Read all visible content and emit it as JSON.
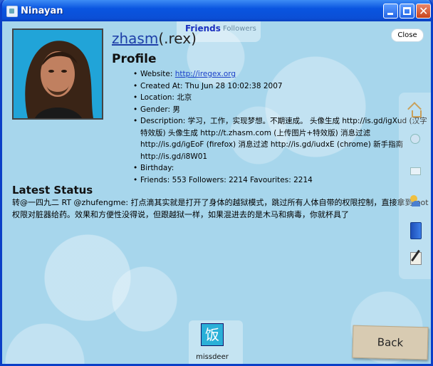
{
  "window": {
    "title": "Ninayan"
  },
  "tabs": {
    "friends": "Friends",
    "followers": "Followers"
  },
  "close_label": "Close",
  "profile": {
    "username": "zhasm",
    "screen_name": "(.rex)",
    "heading": "Profile",
    "website_label": "Website:",
    "website_url": "http://iregex.org",
    "created_at": "Created At: Thu Jun 28 10:02:38 2007",
    "location": "Location: 北京",
    "gender": "Gender: 男",
    "description": "Description: 学习，工作，实现梦想。不期速成。 头像生成 http://is.gd/igXud (汉字特效版) 头像生成 http://t.zhasm.com (上传图片+特效版) 消息过滤 http://is.gd/igEoF (firefox) 消息过滤 http://is.gd/iudxE (chrome) 新手指南 http://is.gd/i8W01",
    "birthday": "Birthday:",
    "counts": "Friends: 553 Followers: 2214 Favourites: 2214"
  },
  "status": {
    "heading": "Latest Status",
    "text": "转@一四九二 RT @zhufengme: 打点滴其实就是打开了身体的越狱模式，跳过所有人体自带的权限控制，直接拿到root权限对脏器给药。效果和方便性没得说，但跟越狱一样，如果混进去的是木马和病毒，你就杯具了"
  },
  "side_icons": [
    "home-icon",
    "smile-icon",
    "mail-icon",
    "people-icon",
    "book-icon",
    "pen-icon"
  ],
  "friend": {
    "name": "missdeer",
    "avatar_glyph": "饭"
  },
  "back_label": "Back"
}
